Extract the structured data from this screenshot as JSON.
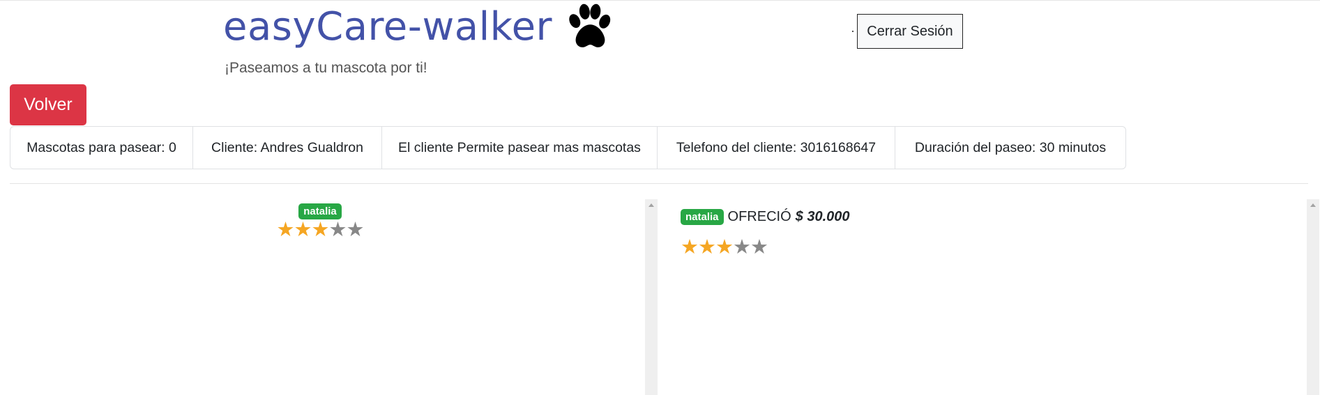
{
  "header": {
    "brand_title": "easyCare-walker",
    "tagline": "¡Paseamos a tu mascota por ti!",
    "separator": "·",
    "logout_label": "Cerrar Sesión"
  },
  "back_label": "Volver",
  "info_items": [
    "Mascotas para pasear: 0",
    "Cliente: Andres Gualdron",
    "El cliente Permite pasear mas mascotas",
    "Telefono del cliente: 3016168647",
    "Duración del paseo: 30 minutos"
  ],
  "left_panel": {
    "walker_name": "natalia",
    "rating": 3,
    "rating_max": 5
  },
  "right_panel": {
    "walker_name": "natalia",
    "offer_word": "OFRECIÓ",
    "offer_amount": "$ 30.000",
    "rating": 3,
    "rating_max": 5
  },
  "colors": {
    "brand": "#4352a8",
    "danger": "#dc3545",
    "badge": "#28a745",
    "star_on": "#f5a623",
    "star_off": "#888888"
  },
  "icons": {
    "brand_icon": "paw-print-icon",
    "star_icon": "star-icon",
    "scroll_icon": "scroll-up-arrow-icon"
  }
}
